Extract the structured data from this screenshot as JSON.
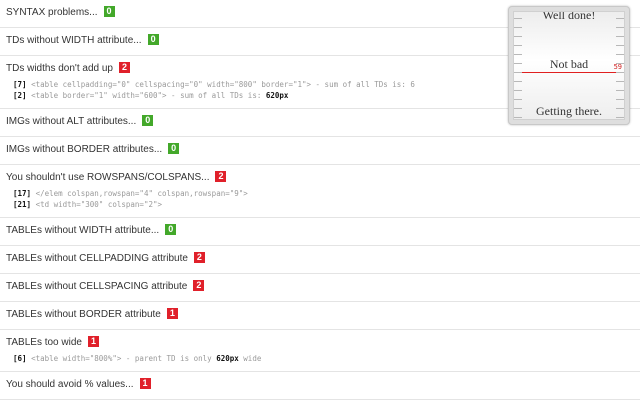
{
  "sections": [
    {
      "title": "SYNTAX problems...",
      "count": "0",
      "status": "ok"
    },
    {
      "title": "TDs without WIDTH attribute...",
      "count": "0",
      "status": "ok"
    },
    {
      "title": "TDs widths don't add up",
      "count": "2",
      "status": "bad",
      "code": [
        {
          "line": "[7]",
          "text": "<table cellpadding=\"0\" cellspacing=\"0\" width=\"800\" border=\"1\"> - sum of all TDs is: 6",
          "highlight": ""
        },
        {
          "line": "[2]",
          "text": "<table border=\"1\" width=\"600\"> - sum of all TDs is: ",
          "highlight": "620px"
        }
      ]
    },
    {
      "title": "IMGs without ALT attributes...",
      "count": "0",
      "status": "ok"
    },
    {
      "title": "IMGs without BORDER attributes...",
      "count": "0",
      "status": "ok"
    },
    {
      "title": "You shouldn't use ROWSPANS/COLSPANS...",
      "count": "2",
      "status": "bad",
      "code": [
        {
          "line": "[17]",
          "text": "</elem colspan,rowspan=\"4\" colspan,rowspan=\"9\">",
          "highlight": ""
        },
        {
          "line": "[21]",
          "text": "<td width=\"300\" colspan=\"2\">",
          "highlight": ""
        }
      ]
    },
    {
      "title": "TABLEs without WIDTH attribute...",
      "count": "0",
      "status": "ok"
    },
    {
      "title": "TABLEs without CELLPADDING attribute",
      "count": "2",
      "status": "bad"
    },
    {
      "title": "TABLEs without CELLSPACING attribute",
      "count": "2",
      "status": "bad"
    },
    {
      "title": "TABLEs without BORDER attribute",
      "count": "1",
      "status": "bad"
    },
    {
      "title": "TABLEs too wide",
      "count": "1",
      "status": "bad",
      "code": [
        {
          "line": "[6]",
          "text": "<table width=\"800%\"> - parent TD is only ",
          "highlight": "620px",
          "after": " wide"
        }
      ]
    },
    {
      "title": "You should avoid % values...",
      "count": "1",
      "status": "bad"
    }
  ],
  "gauge": {
    "top_label": "Well done!",
    "mid_label": "Not bad",
    "bottom_label": "Getting there.",
    "value": "59",
    "needle_fraction": 0.57
  },
  "colors": {
    "ok": "#43a82a",
    "bad": "#e0202a",
    "needle": "#e02020"
  }
}
